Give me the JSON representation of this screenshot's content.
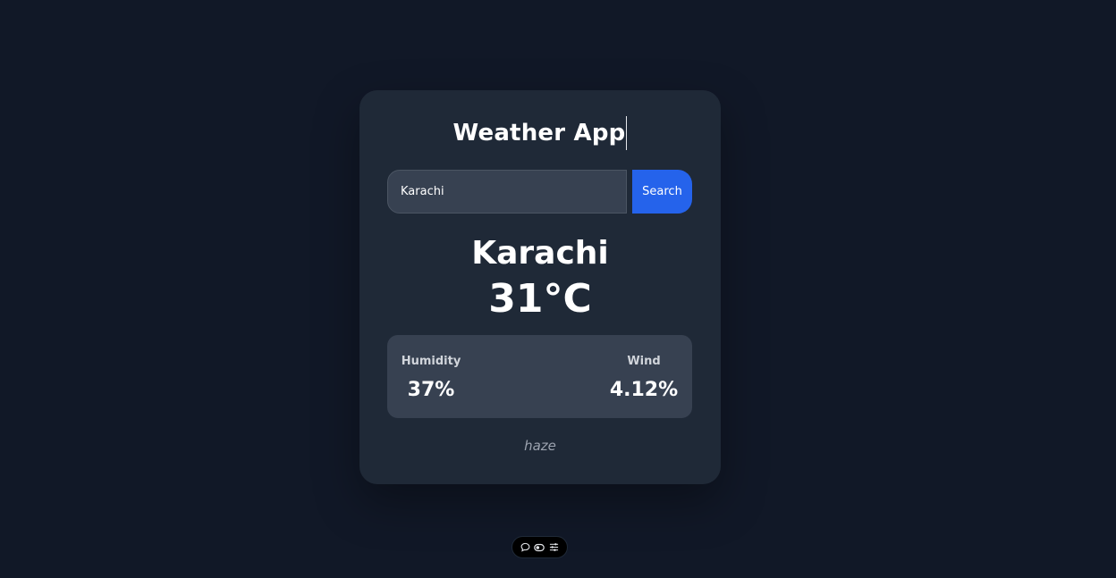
{
  "app": {
    "title": "Weather App"
  },
  "search": {
    "value": "Karachi",
    "button_label": "Search"
  },
  "weather": {
    "city": "Karachi",
    "temperature": "31°C",
    "humidity_label": "Humidity",
    "humidity_value": "37%",
    "wind_label": "Wind",
    "wind_value": "4.12%",
    "condition": "haze"
  },
  "toolbar": {
    "icons": [
      "comment-icon",
      "toggle-icon",
      "sliders-icon"
    ]
  },
  "colors": {
    "background": "#111827",
    "card": "#1f2937",
    "panel": "#374151",
    "accent": "#2563eb"
  }
}
